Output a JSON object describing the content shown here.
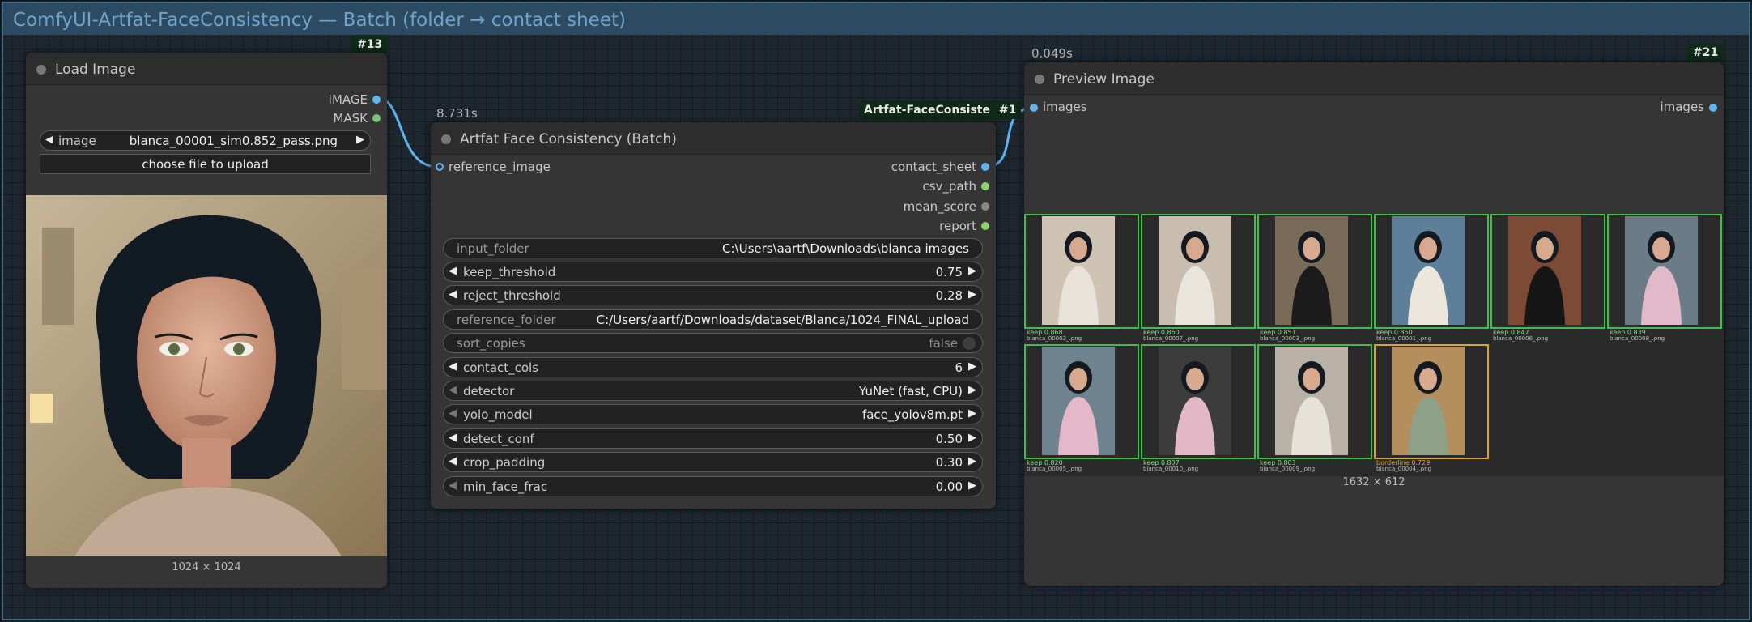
{
  "group": {
    "title": "ComfyUI-Artfat-FaceConsistency — Batch (folder → contact sheet)"
  },
  "load_image": {
    "badge": "#13",
    "title": "Load Image",
    "outputs": [
      "IMAGE",
      "MASK"
    ],
    "image_widget": {
      "label": "image",
      "value": "blanca_00001_sim0.852_pass.png"
    },
    "upload_label": "choose file to upload",
    "dimensions": "1024 × 1024"
  },
  "face_node": {
    "timing": "8.731s",
    "badge_name": "Artfat-FaceConsiste",
    "badge_id": "#1",
    "title": "Artfat Face Consistency (Batch)",
    "input": "reference_image",
    "outputs": [
      "contact_sheet",
      "csv_path",
      "mean_score",
      "report"
    ],
    "widgets": [
      {
        "label": "input_folder",
        "value": "C:\\Users\\aartf\\Downloads\\blanca images",
        "kind": "text"
      },
      {
        "label": "keep_threshold",
        "value": "0.75",
        "kind": "number"
      },
      {
        "label": "reject_threshold",
        "value": "0.28",
        "kind": "number"
      },
      {
        "label": "reference_folder",
        "value": "C:/Users/aartf/Downloads/dataset/Blanca/1024_FINAL_upload",
        "kind": "text"
      },
      {
        "label": "sort_copies",
        "value": "false",
        "kind": "toggle"
      },
      {
        "label": "contact_cols",
        "value": "6",
        "kind": "number"
      },
      {
        "label": "detector",
        "value": "YuNet (fast, CPU)",
        "kind": "combo"
      },
      {
        "label": "yolo_model",
        "value": "face_yolov8m.pt",
        "kind": "combo"
      },
      {
        "label": "detect_conf",
        "value": "0.50",
        "kind": "number"
      },
      {
        "label": "crop_padding",
        "value": "0.30",
        "kind": "number"
      },
      {
        "label": "min_face_frac",
        "value": "0.00",
        "kind": "number"
      }
    ]
  },
  "preview": {
    "timing": "0.049s",
    "badge": "#21",
    "title": "Preview Image",
    "input": "images",
    "output": "images",
    "dimensions": "1632 × 612",
    "thumbs": [
      {
        "score": "keep 0.868",
        "file": "blanca_00002_.png",
        "status": "keep"
      },
      {
        "score": "keep 0.860",
        "file": "blanca_00007_.png",
        "status": "keep"
      },
      {
        "score": "keep 0.851",
        "file": "blanca_00003_.png",
        "status": "keep"
      },
      {
        "score": "keep 0.850",
        "file": "blanca_00001_.png",
        "status": "keep"
      },
      {
        "score": "keep 0.847",
        "file": "blanca_00006_.png",
        "status": "keep"
      },
      {
        "score": "keep 0.839",
        "file": "blanca_00008_.png",
        "status": "keep"
      },
      {
        "score": "keep 0.820",
        "file": "blanca_00005_.png",
        "status": "keep"
      },
      {
        "score": "keep 0.807",
        "file": "blanca_00010_.png",
        "status": "keep"
      },
      {
        "score": "keep 0.803",
        "file": "blanca_00009_.png",
        "status": "keep"
      },
      {
        "score": "borderline 0.729",
        "file": "blanca_00004_.png",
        "status": "border"
      }
    ]
  },
  "colors": {
    "link": "#5fb4f0",
    "keep": "#3fbf4a",
    "borderline": "#d6a72a",
    "group_border": "#3f6d8a"
  }
}
